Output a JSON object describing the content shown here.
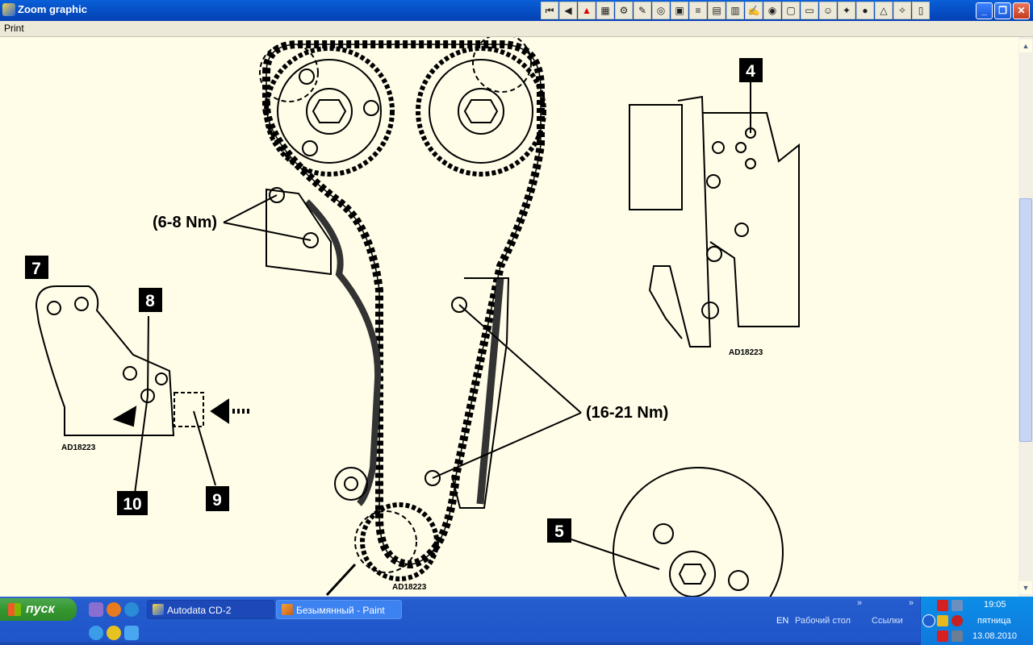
{
  "window": {
    "title": "Zoom graphic"
  },
  "menu": {
    "print_label": "Print"
  },
  "toolbar": {
    "icons": [
      "first-page-icon",
      "previous-page-icon",
      "warning-icon",
      "image-icon",
      "gear-icon",
      "tool-icon",
      "settings-icon",
      "diagram-icon",
      "list-icon",
      "save-icon",
      "table-icon",
      "notes-icon",
      "camera-icon",
      "page-icon",
      "book-icon",
      "face-icon",
      "wrench-icon",
      "user-icon",
      "alert-icon",
      "tool2-icon",
      "doc-icon"
    ]
  },
  "diagram": {
    "torque_upper": "(6-8 Nm)",
    "torque_lower": "(16-21 Nm)",
    "ref_code_left": "AD18223",
    "ref_code_right": "AD18223",
    "ref_code_bottom": "AD18223",
    "callouts": {
      "n4": "4",
      "n5": "5",
      "n7": "7",
      "n8": "8",
      "n9": "9",
      "n10": "10"
    }
  },
  "taskbar": {
    "start_label": "пуск",
    "tasks": [
      {
        "label": "Autodata CD-2",
        "state": "active"
      },
      {
        "label": "Безымянный - Paint",
        "state": "inactive"
      }
    ],
    "toolbars_language": "EN",
    "toolbar_desktop": "Рабочий стол",
    "toolbar_links": "Ссылки",
    "clock_time": "19:05",
    "clock_day": "пятница",
    "clock_date": "13.08.2010"
  },
  "colors": {
    "titlebar": "#0651c6",
    "canvas_bg": "#fffde8",
    "taskbar": "#245ccd",
    "start": "#34962f"
  }
}
